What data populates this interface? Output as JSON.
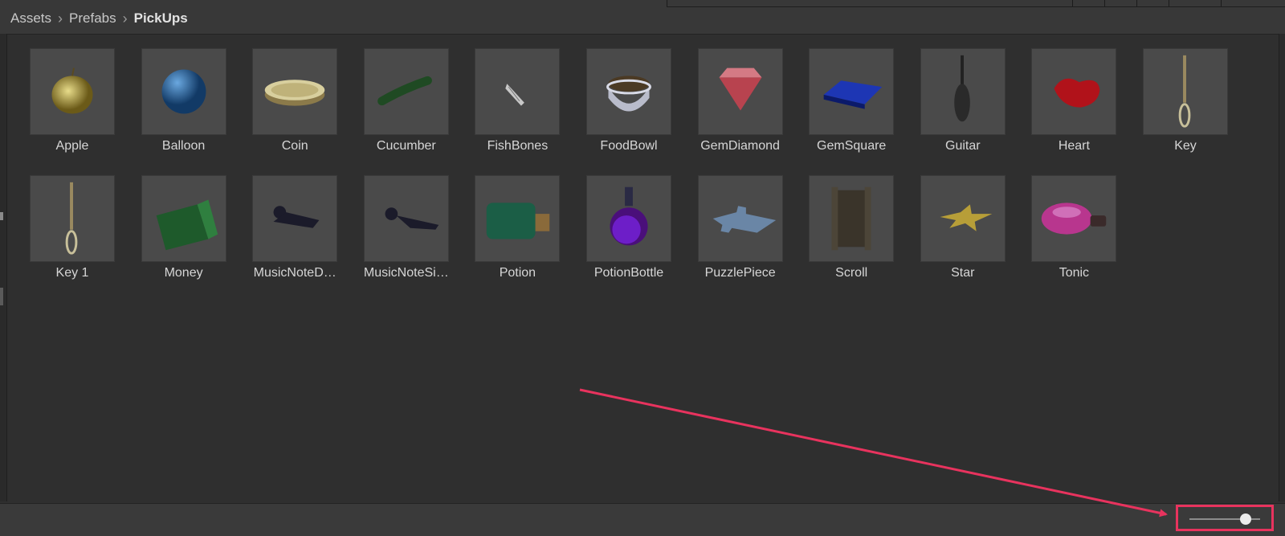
{
  "breadcrumb": {
    "items": [
      "Assets",
      "Prefabs"
    ],
    "current": "PickUps"
  },
  "assets": [
    {
      "label": "Apple",
      "icon": "apple-icon"
    },
    {
      "label": "Balloon",
      "icon": "balloon-icon"
    },
    {
      "label": "Coin",
      "icon": "coin-icon"
    },
    {
      "label": "Cucumber",
      "icon": "cucumber-icon"
    },
    {
      "label": "FishBones",
      "icon": "fishbones-icon"
    },
    {
      "label": "FoodBowl",
      "icon": "foodbowl-icon"
    },
    {
      "label": "GemDiamond",
      "icon": "gemdiamond-icon"
    },
    {
      "label": "GemSquare",
      "icon": "gemsquare-icon"
    },
    {
      "label": "Guitar",
      "icon": "guitar-icon"
    },
    {
      "label": "Heart",
      "icon": "heart-icon"
    },
    {
      "label": "Key",
      "icon": "key-icon"
    },
    {
      "label": "Key 1",
      "icon": "key-icon"
    },
    {
      "label": "Money",
      "icon": "money-icon"
    },
    {
      "label": "MusicNoteD…",
      "icon": "music-note-double-icon"
    },
    {
      "label": "MusicNoteSi…",
      "icon": "music-note-single-icon"
    },
    {
      "label": "Potion",
      "icon": "potion-icon"
    },
    {
      "label": "PotionBottle",
      "icon": "potion-bottle-icon"
    },
    {
      "label": "PuzzlePiece",
      "icon": "puzzle-piece-icon"
    },
    {
      "label": "Scroll",
      "icon": "scroll-icon"
    },
    {
      "label": "Star",
      "icon": "star-icon"
    },
    {
      "label": "Tonic",
      "icon": "tonic-icon"
    }
  ],
  "zoom_slider": {
    "value": 0.8
  },
  "colors": {
    "highlight": "#e8335e",
    "panel_bg": "#2f2f2f",
    "thumb_bg": "#4a4a4a"
  }
}
